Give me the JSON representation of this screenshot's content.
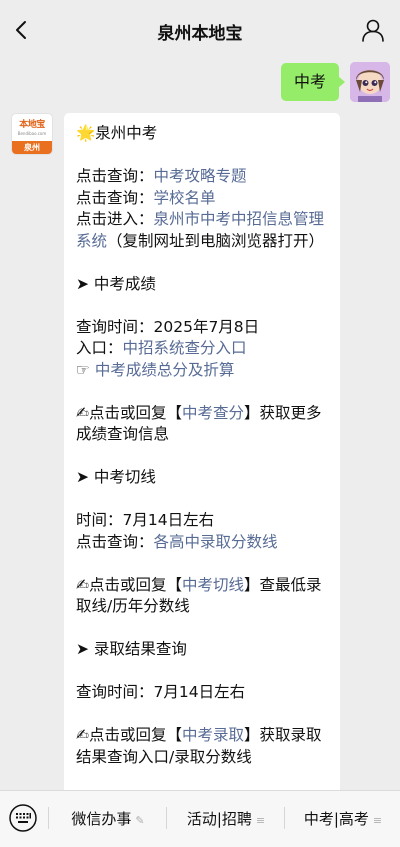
{
  "header": {
    "title": "泉州本地宝"
  },
  "my_message": {
    "text": "中考"
  },
  "bot": {
    "logo_top": "本地宝",
    "logo_url": "Bendibao.com",
    "logo_city": "泉州"
  },
  "message": {
    "l01": "🌟泉州中考",
    "l02_pre": "点击查询：",
    "l02_link": "中考攻略专题",
    "l03_pre": "点击查询：",
    "l03_link": "学校名单",
    "l04_pre": "点击进入：",
    "l04_link": "泉州市中考中招信息管理系统",
    "l04_post": "（复制网址到电脑浏览器打开）",
    "l05": "➤ 中考成绩",
    "l06": "查询时间：2025年7月8日",
    "l07_pre": "入口：",
    "l07_link": "中招系统查分入口",
    "l08_pre": "☞ ",
    "l08_link": "中考成绩总分及折算",
    "l09_pre": "✍点击或回复【",
    "l09_link": "中考查分",
    "l09_post": "】获取更多成绩查询信息",
    "l10": "➤ 中考切线",
    "l11": "时间：7月14日左右",
    "l12_pre": "点击查询：",
    "l12_link": "各高中录取分数线",
    "l13_pre": "✍点击或回复【",
    "l13_link": "中考切线",
    "l13_post": "】查最低录取线/历年分数线",
    "l14": "➤ 录取结果查询",
    "l15": "查询时间：7月14日左右",
    "l16_pre": "✍点击或回复【",
    "l16_link": "中考录取",
    "l16_post": "】获取录取结果查询入口/录取分数线"
  },
  "bottom_menu": {
    "item1": "微信办事",
    "item2": "活动|招聘",
    "item3": "中考|高考"
  }
}
